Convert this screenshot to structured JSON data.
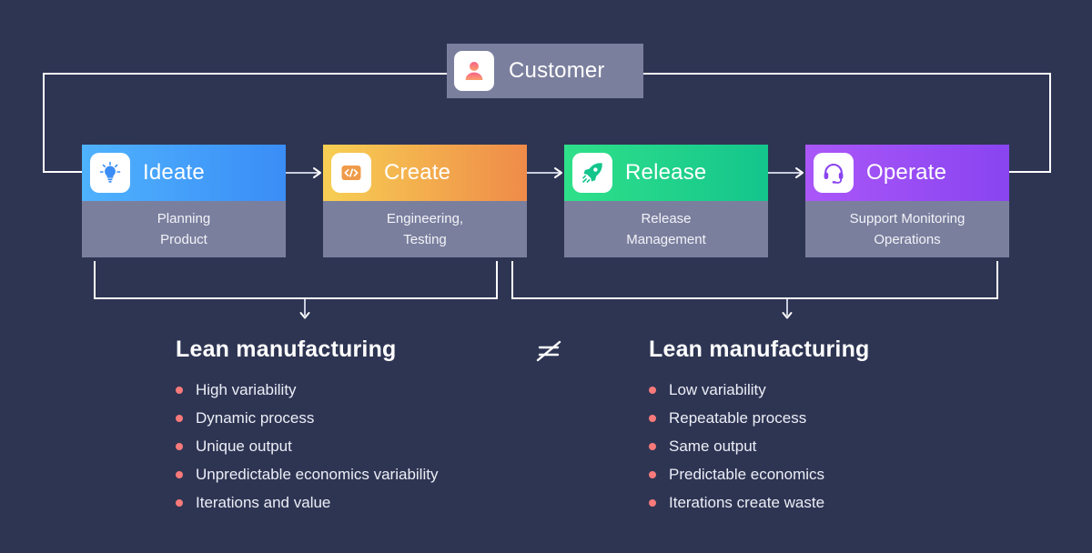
{
  "theme": {
    "background": "#2e3553",
    "line": "#ffffff",
    "sub_box": "#7b7f9e",
    "bullet": "#f97a7a",
    "customer_box": "#7b7f9e"
  },
  "customer": {
    "label": "Customer",
    "icon": "person-icon",
    "icon_gradient_from": "#f8608a",
    "icon_gradient_to": "#fba06a"
  },
  "stages": [
    {
      "title": "Ideate",
      "subtitle": "Planning\nProduct",
      "subtitle_lines": [
        "Planning",
        "Product"
      ],
      "icon": "lightbulb-icon",
      "gradient_from": "#4fb2fd",
      "gradient_to": "#3a8df6"
    },
    {
      "title": "Create",
      "subtitle": "Engineering,\nTesting",
      "subtitle_lines": [
        "Engineering,",
        "Testing"
      ],
      "icon": "code-brackets-icon",
      "gradient_from": "#f7cf53",
      "gradient_to": "#ef8b49"
    },
    {
      "title": "Release",
      "subtitle": "Release\nManagement",
      "subtitle_lines": [
        "Release",
        "Management"
      ],
      "icon": "rocket-icon",
      "gradient_from": "#2fe08a",
      "gradient_to": "#14c58c"
    },
    {
      "title": "Operate",
      "subtitle": "Support Monitoring\nOperations",
      "subtitle_lines": [
        "Support Monitoring",
        "Operations"
      ],
      "icon": "headset-icon",
      "gradient_from": "#aa57f8",
      "gradient_to": "#8944f0"
    }
  ],
  "comparison": {
    "operator": "≠",
    "left": {
      "title": "Lean manufacturing",
      "items": [
        "High variability",
        "Dynamic process",
        "Unique output",
        "Unpredictable economics variability",
        "Iterations and value"
      ]
    },
    "right": {
      "title": "Lean manufacturing",
      "items": [
        "Low variability",
        "Repeatable process",
        "Same output",
        "Predictable economics",
        "Iterations create waste"
      ]
    }
  }
}
